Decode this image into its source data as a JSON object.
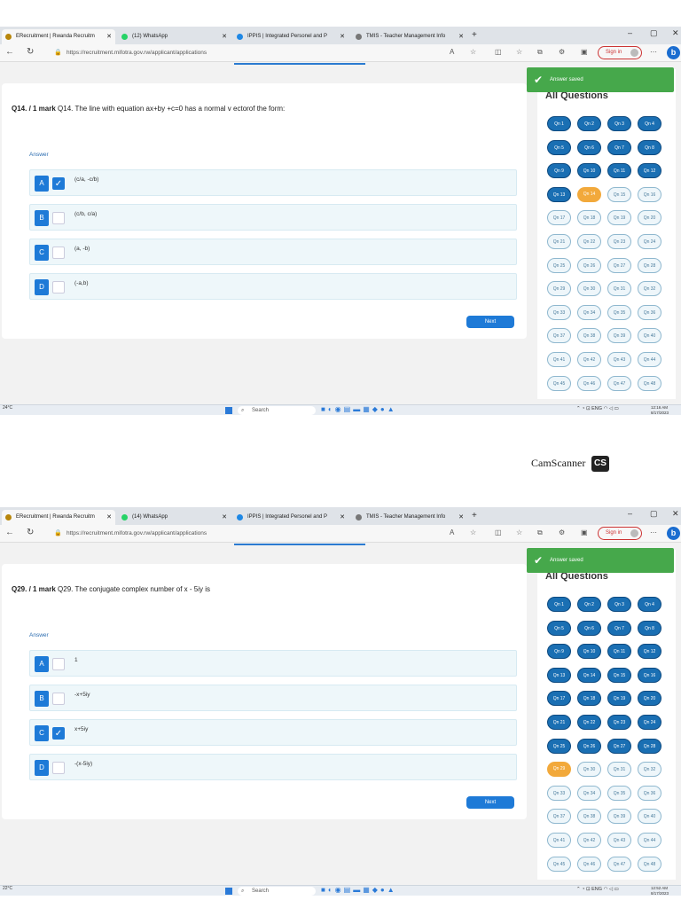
{
  "browser": {
    "tabs": [
      {
        "label": "ERecruitment | Rwanda Recruitm",
        "icon": "recruitment-icon",
        "active": true
      },
      {
        "label": "(12) WhatsApp",
        "icon": "whatsapp-icon"
      },
      {
        "label": "IPPIS | Integrated Personel and P",
        "icon": "ippis-icon"
      },
      {
        "label": "TMIS - Teacher Management Info",
        "icon": "tmis-icon"
      }
    ],
    "tabs2_whatsapp": "(14) WhatsApp",
    "url": "https://recruitment.mifotra.gov.rw/applicant/applications",
    "signin": "Sign in"
  },
  "toast": {
    "text": "Answer saved"
  },
  "sidebar": {
    "title": "All Questions"
  },
  "shot1": {
    "question_num": "Q14. / 1 mark",
    "question_text": "Q14. The line with equation ax+by +c=0 has a normal v ectorof the form:",
    "answer_label": "Answer",
    "options": [
      {
        "letter": "A",
        "text": "(c/a, -c/b)",
        "checked": true
      },
      {
        "letter": "B",
        "text": "(c/b, c/a)",
        "checked": false
      },
      {
        "letter": "C",
        "text": "(a, -b)",
        "checked": false
      },
      {
        "letter": "D",
        "text": "(-a,b)",
        "checked": false
      }
    ],
    "next": "Next",
    "answered_until": 13,
    "current": 14
  },
  "shot2": {
    "question_num": "Q29. / 1 mark",
    "question_text": "Q29. The conjugate complex number of x - 5iy  is",
    "answer_label": "Answer",
    "options": [
      {
        "letter": "A",
        "text": "1",
        "checked": false
      },
      {
        "letter": "B",
        "text": "-x+5iy",
        "checked": false
      },
      {
        "letter": "C",
        "text": "x+5iy",
        "checked": true
      },
      {
        "letter": "D",
        "text": "-(x-5iy)",
        "checked": false
      }
    ],
    "next": "Next",
    "answered_until": 28,
    "current": 29
  },
  "question_count": 48,
  "question_prefix": "Qn ",
  "taskbar": {
    "weather1": "24°C",
    "weather2": "22°C",
    "weather2_sub": "Mostly sunny",
    "search": "Search",
    "lang": "ENG",
    "region": "US",
    "time1": "12:16 AM",
    "time2": "12:52 AM",
    "date": "8/17/2023"
  },
  "watermark": {
    "text": "CamScanner",
    "logo": "CS"
  }
}
